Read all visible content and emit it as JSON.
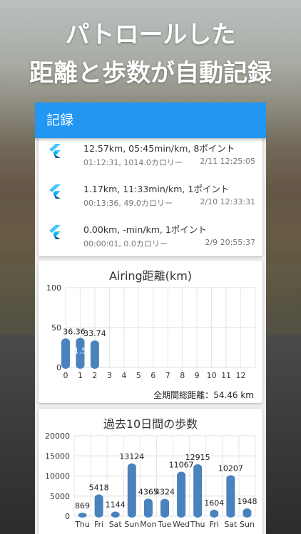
{
  "headline": {
    "line1": "パトロールした",
    "line2": "距離と歩数が自動記録"
  },
  "appbar": {
    "title": "記録"
  },
  "records": [
    {
      "summary": "12.57km,  05:45min/km,  8ポイント",
      "detail": "01:12:31,  1014.0カロリー",
      "date": "2/11 12:25:05",
      "icon": "flutter-logo-icon"
    },
    {
      "summary": "1.17km,  11:33min/km,  1ポイント",
      "detail": "00:13:36,  49.0カロリー",
      "date": "2/10 12:33:31",
      "icon": "flutter-logo-icon"
    },
    {
      "summary": "0.00km,  -min/km,  1ポイント",
      "detail": "00:00:01,  0.0カロリー",
      "date": "2/9 20:55:37",
      "icon": "flutter-logo-icon"
    }
  ],
  "distance_footer": {
    "label": "全期間総距離：",
    "value": "54.46 km"
  },
  "colors": {
    "accent": "#2196f3",
    "bar": "#4a82bd"
  },
  "chart_data": [
    {
      "type": "bar",
      "title": "Airing距離(km)",
      "categories": [
        "0",
        "1",
        "2",
        "3",
        "4",
        "5",
        "6",
        "7",
        "8",
        "9",
        "10",
        "11",
        "12"
      ],
      "values": [
        36.36,
        37,
        33.74,
        null,
        null,
        null,
        null,
        null,
        null,
        null,
        null,
        null,
        null
      ],
      "data_labels": [
        "36.36",
        "1.5",
        "33.74"
      ],
      "yticks": [
        "0",
        "50",
        "100"
      ],
      "ylim": [
        0,
        100
      ],
      "grid": true
    },
    {
      "type": "bar",
      "title": "過去10日間の歩数",
      "categories": [
        "Thu",
        "Fri",
        "Sat",
        "Sun",
        "Mon",
        "Tue",
        "Wed",
        "Thu",
        "Fri",
        "Sat",
        "Sun"
      ],
      "values": [
        869,
        5418,
        1144,
        13124,
        4365,
        4324,
        11067,
        12915,
        1604,
        10207,
        1948
      ],
      "data_labels": [
        "869",
        "5418",
        "1144",
        "13124",
        "4365",
        "4324",
        "11067",
        "12915",
        "1604",
        "10207",
        "1948"
      ],
      "yticks": [
        "0",
        "5000",
        "10000",
        "15000",
        "20000"
      ],
      "ylim": [
        0,
        20000
      ],
      "grid": true
    }
  ]
}
